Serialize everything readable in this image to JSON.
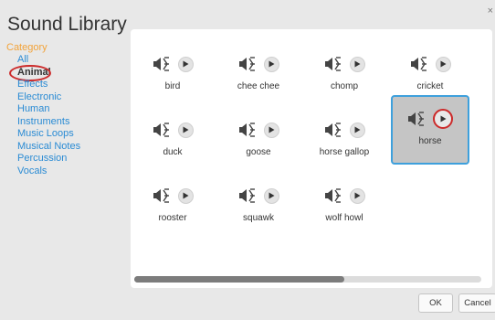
{
  "dialog": {
    "title": "Sound Library",
    "close_glyph": "×"
  },
  "sidebar": {
    "heading": "Category",
    "items": [
      {
        "label": "All"
      },
      {
        "label": "Animal",
        "selected": true
      },
      {
        "label": "Effects"
      },
      {
        "label": "Electronic"
      },
      {
        "label": "Human"
      },
      {
        "label": "Instruments"
      },
      {
        "label": "Music Loops"
      },
      {
        "label": "Musical Notes"
      },
      {
        "label": "Percussion"
      },
      {
        "label": "Vocals"
      }
    ]
  },
  "sounds": [
    {
      "label": "bird",
      "icon": "speaker-icon"
    },
    {
      "label": "chee chee",
      "icon": "speaker-icon"
    },
    {
      "label": "chomp",
      "icon": "speaker-icon"
    },
    {
      "label": "cricket",
      "icon": "speaker-icon"
    },
    {
      "label": "duck",
      "icon": "speaker-icon"
    },
    {
      "label": "goose",
      "icon": "speaker-icon"
    },
    {
      "label": "horse gallop",
      "icon": "speaker-icon"
    },
    {
      "label": "horse",
      "icon": "speaker-icon",
      "selected": true
    },
    {
      "label": "rooster",
      "icon": "speaker-icon"
    },
    {
      "label": "squawk",
      "icon": "speaker-icon"
    },
    {
      "label": "wolf howl",
      "icon": "speaker-icon"
    }
  ],
  "buttons": {
    "ok": "OK",
    "cancel": "Cancel"
  },
  "colors": {
    "category_heading": "#f2a33a",
    "category_link": "#2a8bd4",
    "selection_border": "#3ea0dc",
    "annotation_red": "#cc2a2a"
  }
}
